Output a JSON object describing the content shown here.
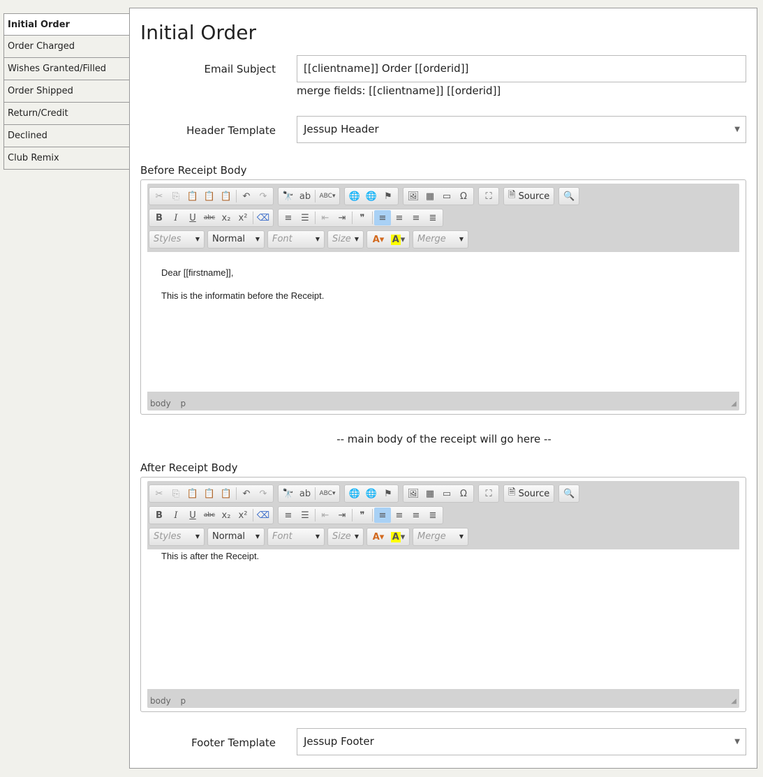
{
  "sidebar": {
    "items": [
      {
        "label": "Initial Order"
      },
      {
        "label": "Order Charged"
      },
      {
        "label": "Wishes Granted/Filled"
      },
      {
        "label": "Order Shipped"
      },
      {
        "label": "Return/Credit"
      },
      {
        "label": "Declined"
      },
      {
        "label": "Club Remix"
      }
    ]
  },
  "page": {
    "title": "Initial Order"
  },
  "email_subject": {
    "label": "Email Subject",
    "value": "[[clientname]] Order [[orderid]]",
    "hint": "merge fields: [[clientname]] [[orderid]]"
  },
  "header_template": {
    "label": "Header Template",
    "value": "Jessup Header"
  },
  "before_receipt": {
    "label": "Before Receipt Body",
    "paragraphs": [
      "Dear [[firstname]],",
      "This is the informatin before the Receipt."
    ],
    "status": [
      "body",
      "p"
    ]
  },
  "middle_text": "-- main body of the receipt will go here --",
  "after_receipt": {
    "label": "After Receipt Body",
    "paragraphs": [
      "This is after the Receipt."
    ],
    "status": [
      "body",
      "p"
    ]
  },
  "footer_template": {
    "label": "Footer Template",
    "value": "Jessup Footer"
  },
  "toolbar": {
    "source_label": "Source",
    "styles_label": "Styles",
    "format_label": "Normal",
    "font_label": "Font",
    "size_label": "Size",
    "merge_label": "Merge",
    "bold_glyph": "B",
    "italic_glyph": "I",
    "underline_glyph": "U",
    "strike_glyph": "abc",
    "subscript_glyph": "x₂",
    "superscript_glyph": "x²",
    "text_color_glyph": "A",
    "bg_color_glyph": "A"
  },
  "colors": {
    "active_button": "#a9d1f5",
    "highlight_yellow": "#ffff00",
    "editor_chrome": "#d3d3d3"
  }
}
